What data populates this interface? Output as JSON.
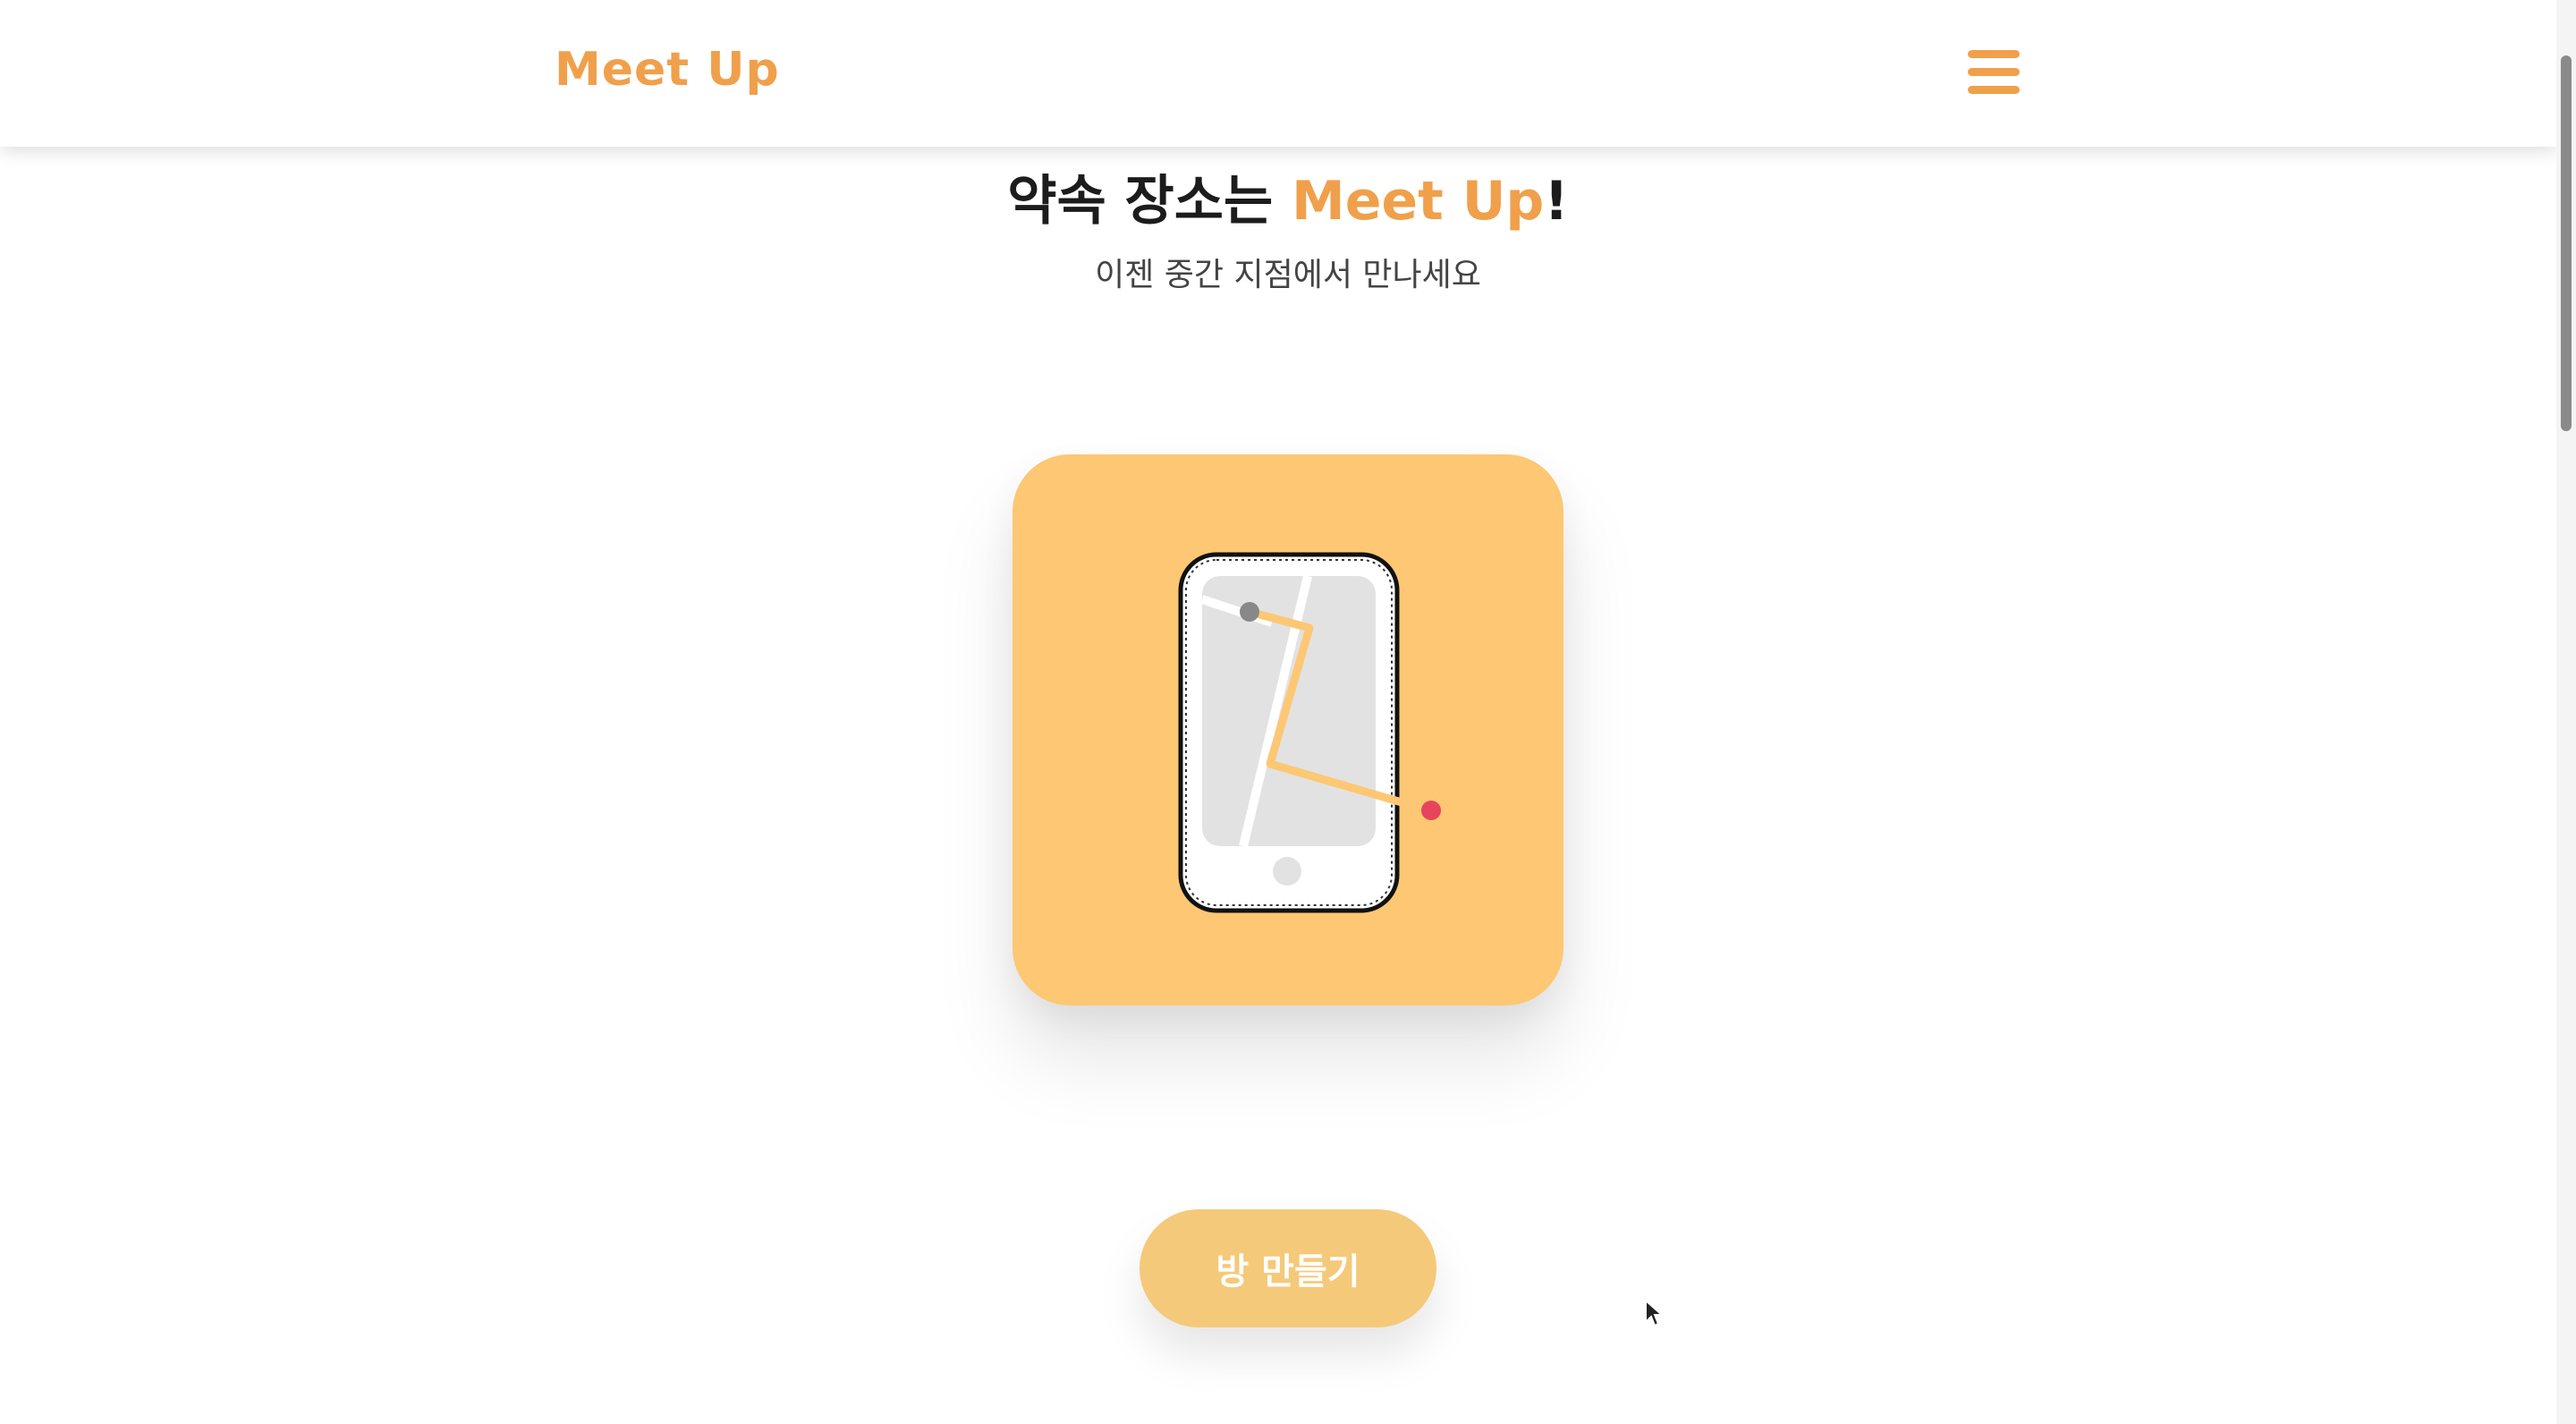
{
  "header": {
    "logo_text": "Meet Up",
    "menu_icon": "hamburger-menu-icon"
  },
  "hero": {
    "title_prefix": "약속 장소는 ",
    "title_accent": "Meet Up",
    "title_suffix": "!",
    "subtitle": "이젠 중간 지점에서 만나세요"
  },
  "illustration": {
    "icon": "phone-map-route-icon",
    "card_color": "#fdc773",
    "route_color": "#fdc773",
    "start_marker_color": "#888888",
    "end_marker_color": "#e8455c"
  },
  "cta": {
    "label": "방 만들기",
    "color": "#f5c97a"
  },
  "colors": {
    "accent": "#f0a04b"
  }
}
